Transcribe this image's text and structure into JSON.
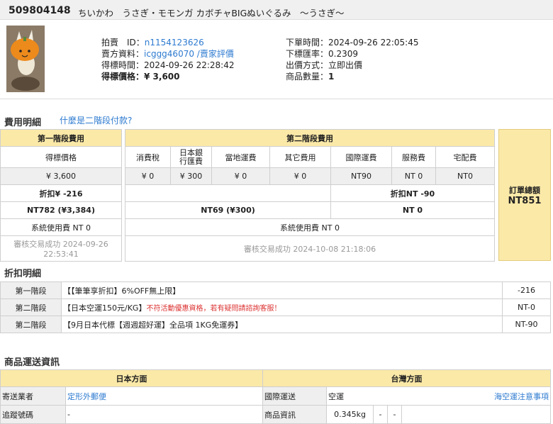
{
  "header": {
    "id": "509804148",
    "name": "ちいかわ　うさぎ・モモンガ カボチャBIGぬいぐるみ　～うさぎ～"
  },
  "info": {
    "left": [
      {
        "label": "拍賣　ID：",
        "value": "n1154123626",
        "link": true
      },
      {
        "label": "賣方資料：",
        "value": "icggg46070",
        "link": true,
        "extra": " /賣家評價"
      },
      {
        "label": "得標時間：",
        "value": "2024-09-26 22:28:42",
        "link": false
      },
      {
        "label": "得標價格：",
        "value": "¥ 3,600",
        "link": false,
        "bold": true
      }
    ],
    "right": [
      {
        "label": "下單時間：",
        "value": "2024-09-26 22:05:45"
      },
      {
        "label": "下標匯率：",
        "value": "0.2309"
      },
      {
        "label": "出價方式：",
        "value": "立即出價"
      },
      {
        "label": "商品數量：",
        "value": "1",
        "bold": true
      }
    ]
  },
  "fees": {
    "title": "費用明細",
    "help": "什麼是二階段付款?",
    "stage1": "第一階段費用",
    "stage2": "第二階段費用",
    "col1": "得標價格",
    "cols2": [
      "消費稅",
      "日本銀\n行匯費",
      "當地運費",
      "其它費用",
      "國際運費",
      "服務費",
      "宅配費"
    ],
    "v1": "¥ 3,600",
    "vals2": [
      "¥ 0",
      "¥ 300",
      "¥ 0",
      "¥ 0",
      "NT90",
      "NT 0",
      "NT0"
    ],
    "d1": "折扣¥ -216",
    "d2": "折扣NT -90",
    "s1": "NT782 (¥3,384)",
    "s2a": "NT69 (¥300)",
    "s2b": "NT 0",
    "sys1": "系統使用費 NT 0",
    "sys2": "系統使用費 NT 0",
    "ok1": "審核交易成功 2024-09-26 22:53:41",
    "ok2": "審核交易成功 2024-10-08 21:18:06",
    "total_label": "訂單總額",
    "total": "NT851"
  },
  "discounts": {
    "title": "折扣明細",
    "rows": [
      {
        "stage": "第一階段",
        "desc": "【【筆筆享折扣】6%OFF無上限】",
        "note": "",
        "amt": "-216"
      },
      {
        "stage": "第二階段",
        "desc": "【日本空運150元/KG】",
        "note": "不符活動優惠資格，若有疑問請諮詢客服！",
        "amt": "NT-0"
      },
      {
        "stage": "第二階段",
        "desc": "【9月日本代標【週週超好運】全品項 1KG免運券】",
        "note": "",
        "amt": "NT-90"
      }
    ]
  },
  "shipping": {
    "title": "商品運送資訊",
    "jp": "日本方面",
    "tw": "台灣方面",
    "r1": {
      "a": "寄送業者",
      "b": "定形外郵便",
      "c": "國際運送",
      "d": "空運",
      "e": "海空運注意事項"
    },
    "r2": {
      "a": "追蹤號碼",
      "b": "-",
      "c": "商品資訊",
      "d": "0.345kg",
      "e": "-",
      "f": "-"
    }
  }
}
